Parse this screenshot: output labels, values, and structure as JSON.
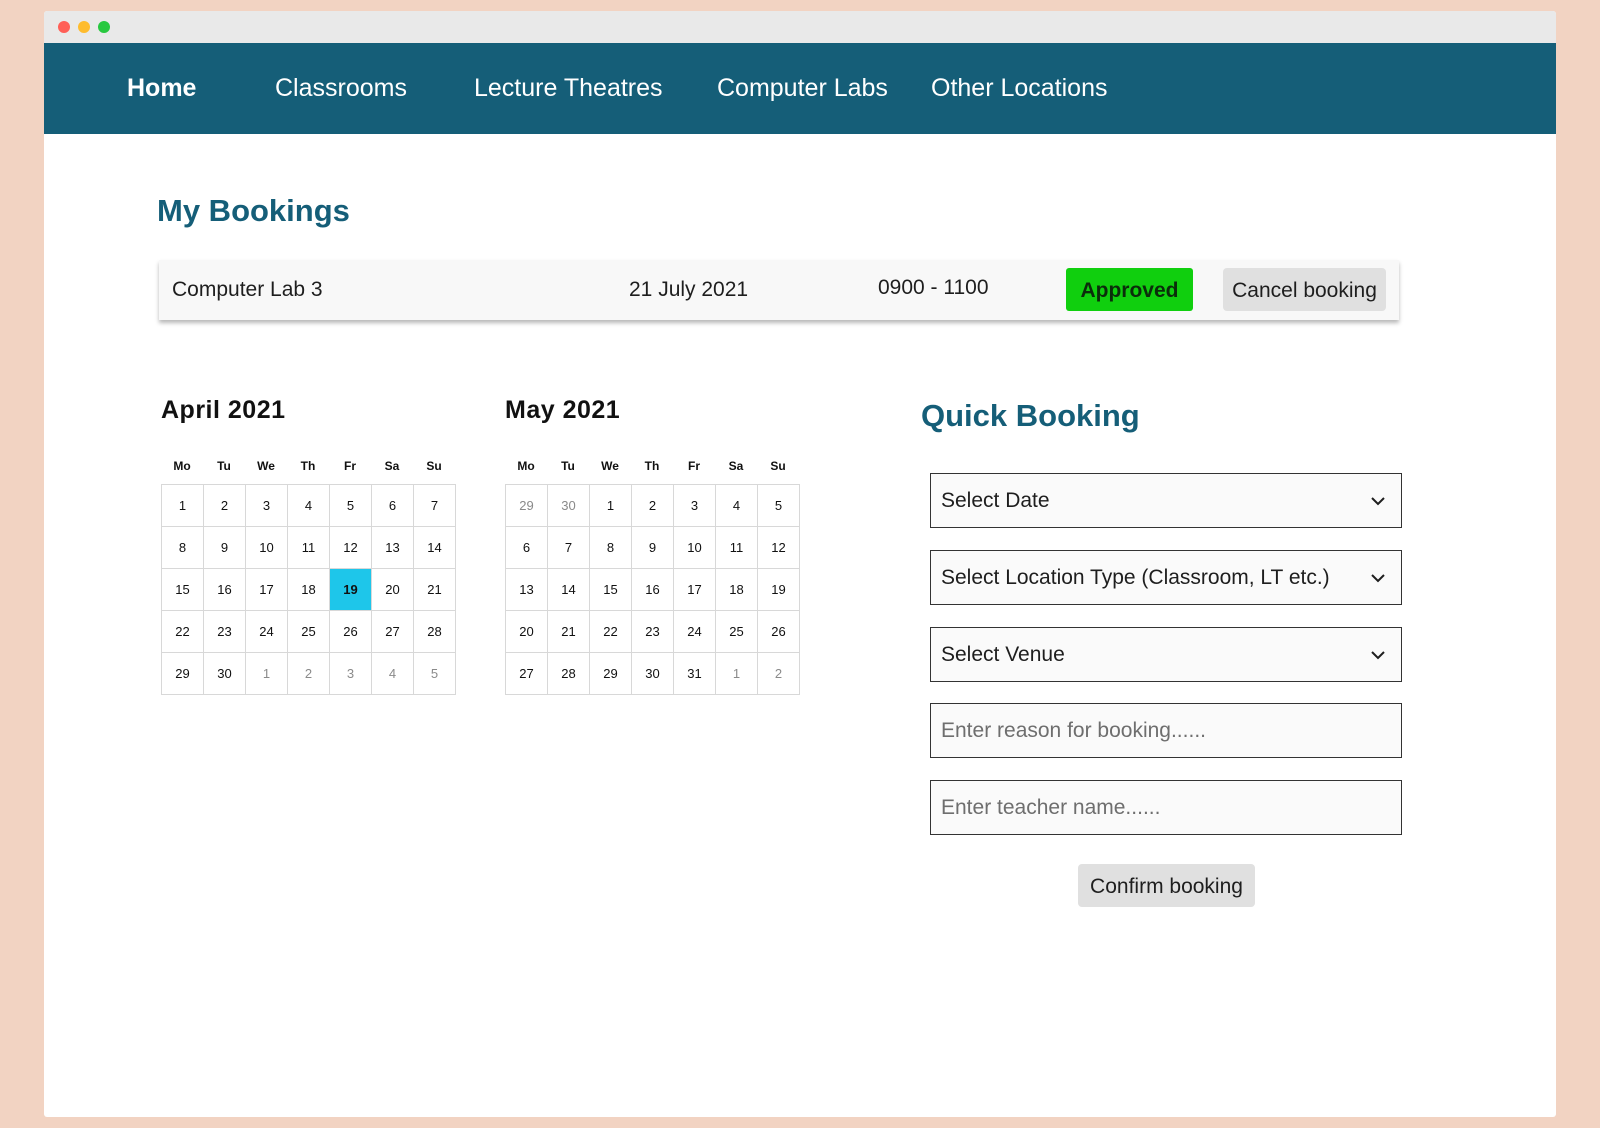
{
  "nav": {
    "items": [
      {
        "label": "Home",
        "active": true
      },
      {
        "label": "Classrooms"
      },
      {
        "label": "Lecture Theatres"
      },
      {
        "label": "Computer Labs"
      },
      {
        "label": "Other Locations"
      }
    ]
  },
  "my_bookings": {
    "title": "My Bookings",
    "booking": {
      "venue": "Computer Lab 3",
      "date": "21 July 2021",
      "time": "0900 - 1100",
      "status": "Approved",
      "cancel_label": "Cancel booking"
    }
  },
  "calendars": {
    "weekdays": [
      "Mo",
      "Tu",
      "We",
      "Th",
      "Fr",
      "Sa",
      "Su"
    ],
    "april": {
      "title": "April 2021",
      "selected_day": "19",
      "days": [
        "1",
        "2",
        "3",
        "4",
        "5",
        "6",
        "7",
        "8",
        "9",
        "10",
        "11",
        "12",
        "13",
        "14",
        "15",
        "16",
        "17",
        "18",
        "19",
        "20",
        "21",
        "22",
        "23",
        "24",
        "25",
        "26",
        "27",
        "28",
        "29",
        "30",
        "1",
        "2",
        "3",
        "4",
        "5"
      ],
      "muted_indices": [
        30,
        31,
        32,
        33,
        34
      ]
    },
    "may": {
      "title": "May 2021",
      "days": [
        "29",
        "30",
        "1",
        "2",
        "3",
        "4",
        "5",
        "6",
        "7",
        "8",
        "9",
        "10",
        "11",
        "12",
        "13",
        "14",
        "15",
        "16",
        "17",
        "18",
        "19",
        "20",
        "21",
        "22",
        "23",
        "24",
        "25",
        "26",
        "27",
        "28",
        "29",
        "30",
        "31",
        "1",
        "2"
      ],
      "muted_indices": [
        0,
        1,
        33,
        34
      ]
    }
  },
  "quick_booking": {
    "title": "Quick Booking",
    "select_date": "Select Date",
    "select_location_type": "Select Location Type (Classroom, LT etc.)",
    "select_venue": "Select Venue",
    "reason_placeholder": "Enter reason for booking......",
    "teacher_placeholder": "Enter teacher name......",
    "confirm_label": "Confirm booking"
  },
  "colors": {
    "nav_bg": "#155e78",
    "accent_title": "#155e78",
    "approved": "#10cf0e",
    "selected_day": "#1ec6ea",
    "page_bg": "#f2d3c2"
  }
}
